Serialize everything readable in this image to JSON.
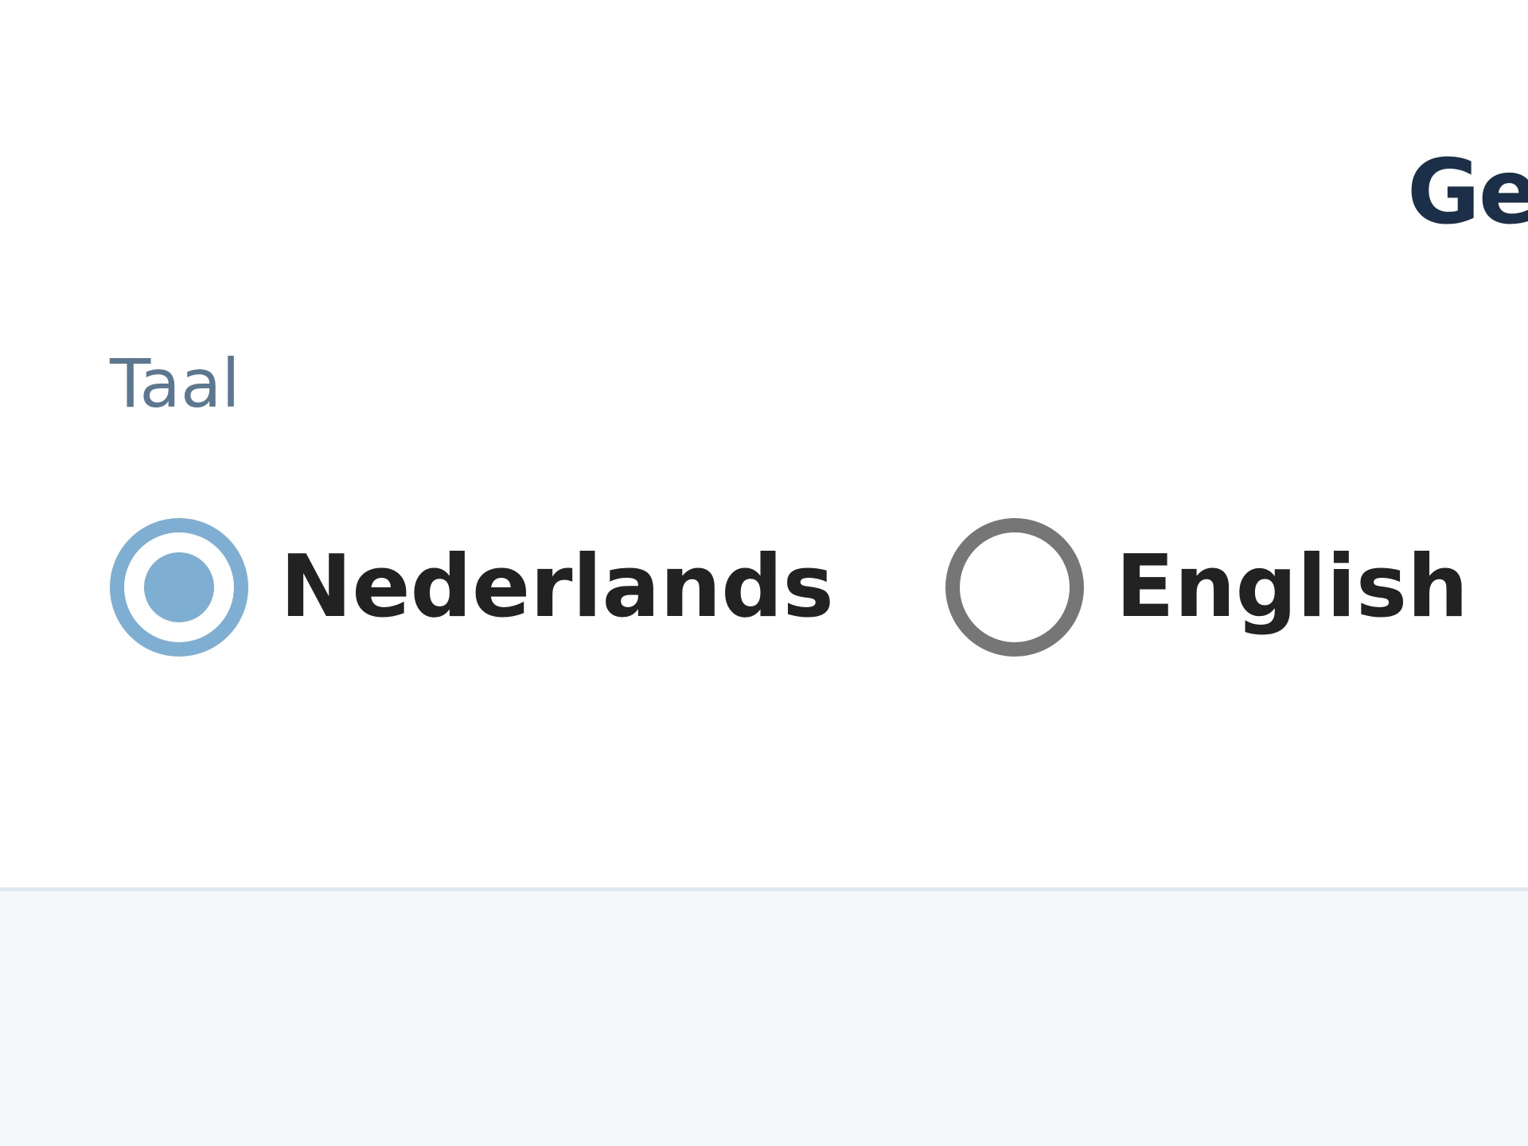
{
  "card": {
    "title": "Ge"
  },
  "language_field": {
    "label": "Taal",
    "selected": "Nederlands",
    "options": [
      {
        "label": "Nederlands",
        "checked": true
      },
      {
        "label": "English",
        "checked": false
      }
    ]
  },
  "colors": {
    "accent": "#7eaed1",
    "unchecked_border": "#767676",
    "label_text": "#5b7890",
    "title_text": "#1b2f48",
    "option_text": "#222222",
    "page_background": "#f5f8fb",
    "card_background": "#ffffff"
  }
}
